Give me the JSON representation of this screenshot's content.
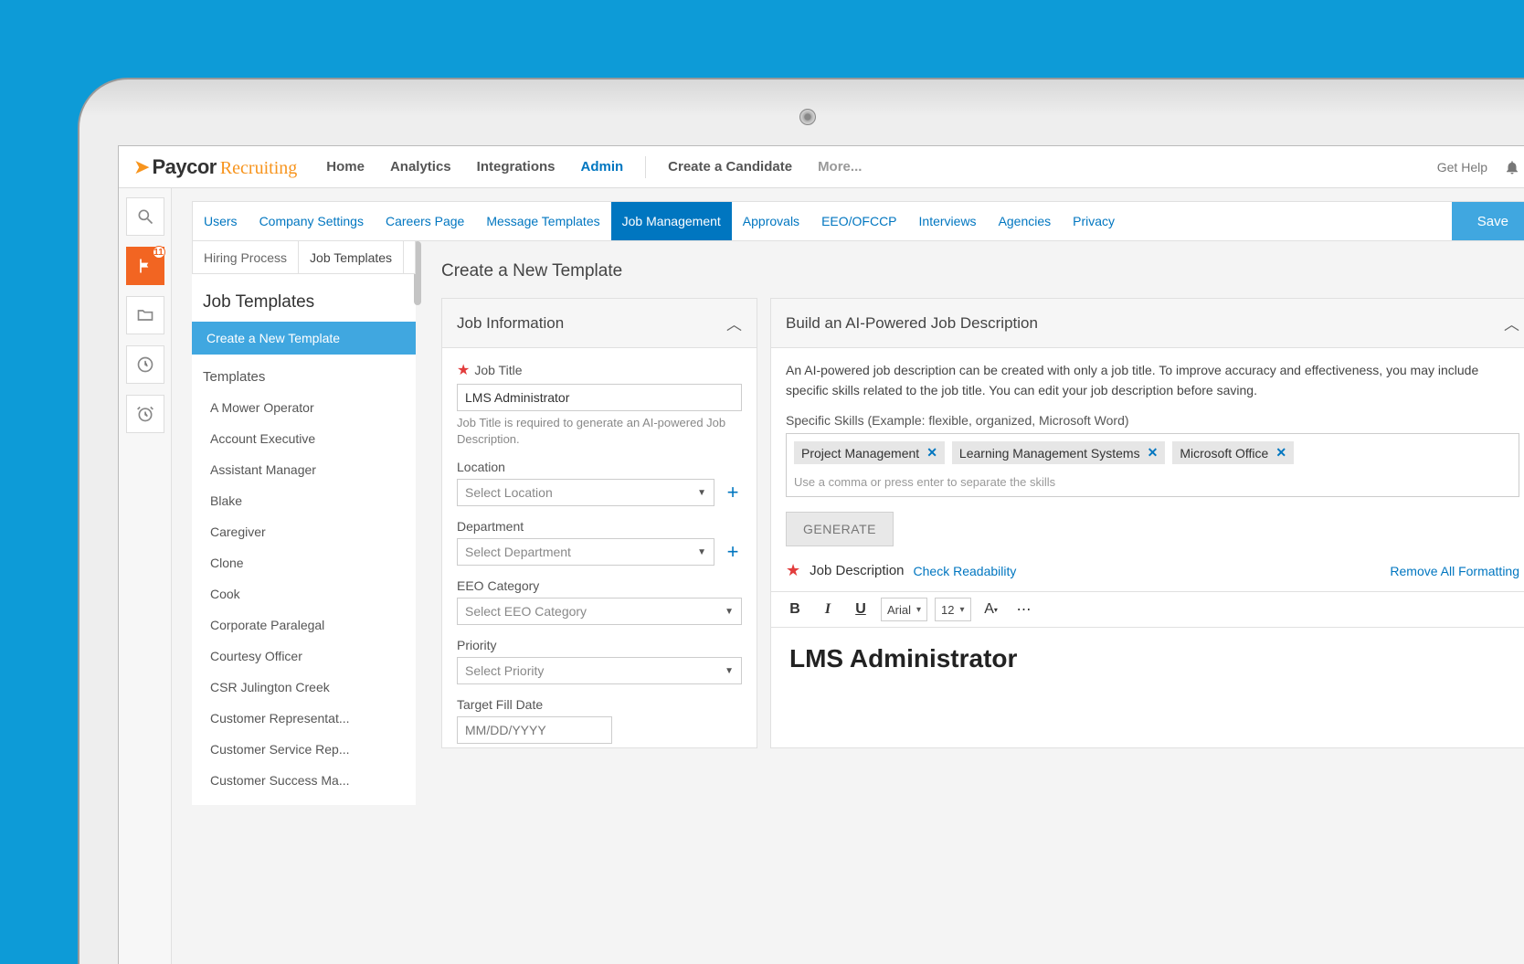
{
  "brand": {
    "name": "Paycor",
    "sub": "Recruiting"
  },
  "topnav": {
    "items": [
      "Home",
      "Analytics",
      "Integrations",
      "Admin"
    ],
    "active": "Admin",
    "create": "Create a Candidate",
    "more": "More...",
    "help": "Get Help"
  },
  "rail": {
    "badge": "11"
  },
  "subnav": {
    "items": [
      "Users",
      "Company Settings",
      "Careers Page",
      "Message Templates",
      "Job Management",
      "Approvals",
      "EEO/OFCCP",
      "Interviews",
      "Agencies",
      "Privacy"
    ],
    "active": "Job Management",
    "save": "Save"
  },
  "tabs": {
    "items": [
      "Hiring Process",
      "Job Templates"
    ],
    "active": "Job Templates"
  },
  "left": {
    "heading": "Job Templates",
    "create": "Create a New Template",
    "section": "Templates",
    "templates": [
      "A Mower Operator",
      "Account Executive",
      "Assistant Manager",
      "Blake",
      "Caregiver",
      "Clone",
      "Cook",
      "Corporate Paralegal",
      "Courtesy Officer",
      "CSR Julington Creek",
      "Customer Representat...",
      "Customer Service Rep...",
      "Customer Success Ma..."
    ]
  },
  "page": {
    "title": "Create a New Template"
  },
  "jobinfo": {
    "header": "Job Information",
    "title_label": "Job Title",
    "title_value": "LMS Administrator",
    "title_hint": "Job Title is required to generate an AI-powered Job Description.",
    "location_label": "Location",
    "location_ph": "Select Location",
    "dept_label": "Department",
    "dept_ph": "Select Department",
    "eeo_label": "EEO Category",
    "eeo_ph": "Select EEO Category",
    "priority_label": "Priority",
    "priority_ph": "Select Priority",
    "target_label": "Target Fill Date",
    "target_ph": "MM/DD/YYYY"
  },
  "ai": {
    "header": "Build an AI-Powered Job Description",
    "desc": "An AI-powered job description can be created with only a job title. To improve accuracy and effectiveness, you may include specific skills related to the job title. You can edit your job description before saving.",
    "skills_label": "Specific Skills (Example: flexible, organized, Microsoft Word)",
    "chips": [
      "Project Management",
      "Learning Management Systems",
      "Microsoft Office"
    ],
    "skills_ph": "Use a comma or press enter to separate the skills",
    "generate": "GENERATE"
  },
  "jd": {
    "label": "Job Description",
    "check": "Check Readability",
    "remove": "Remove All Formatting",
    "font": "Arial",
    "size": "12",
    "heading": "LMS Administrator"
  }
}
